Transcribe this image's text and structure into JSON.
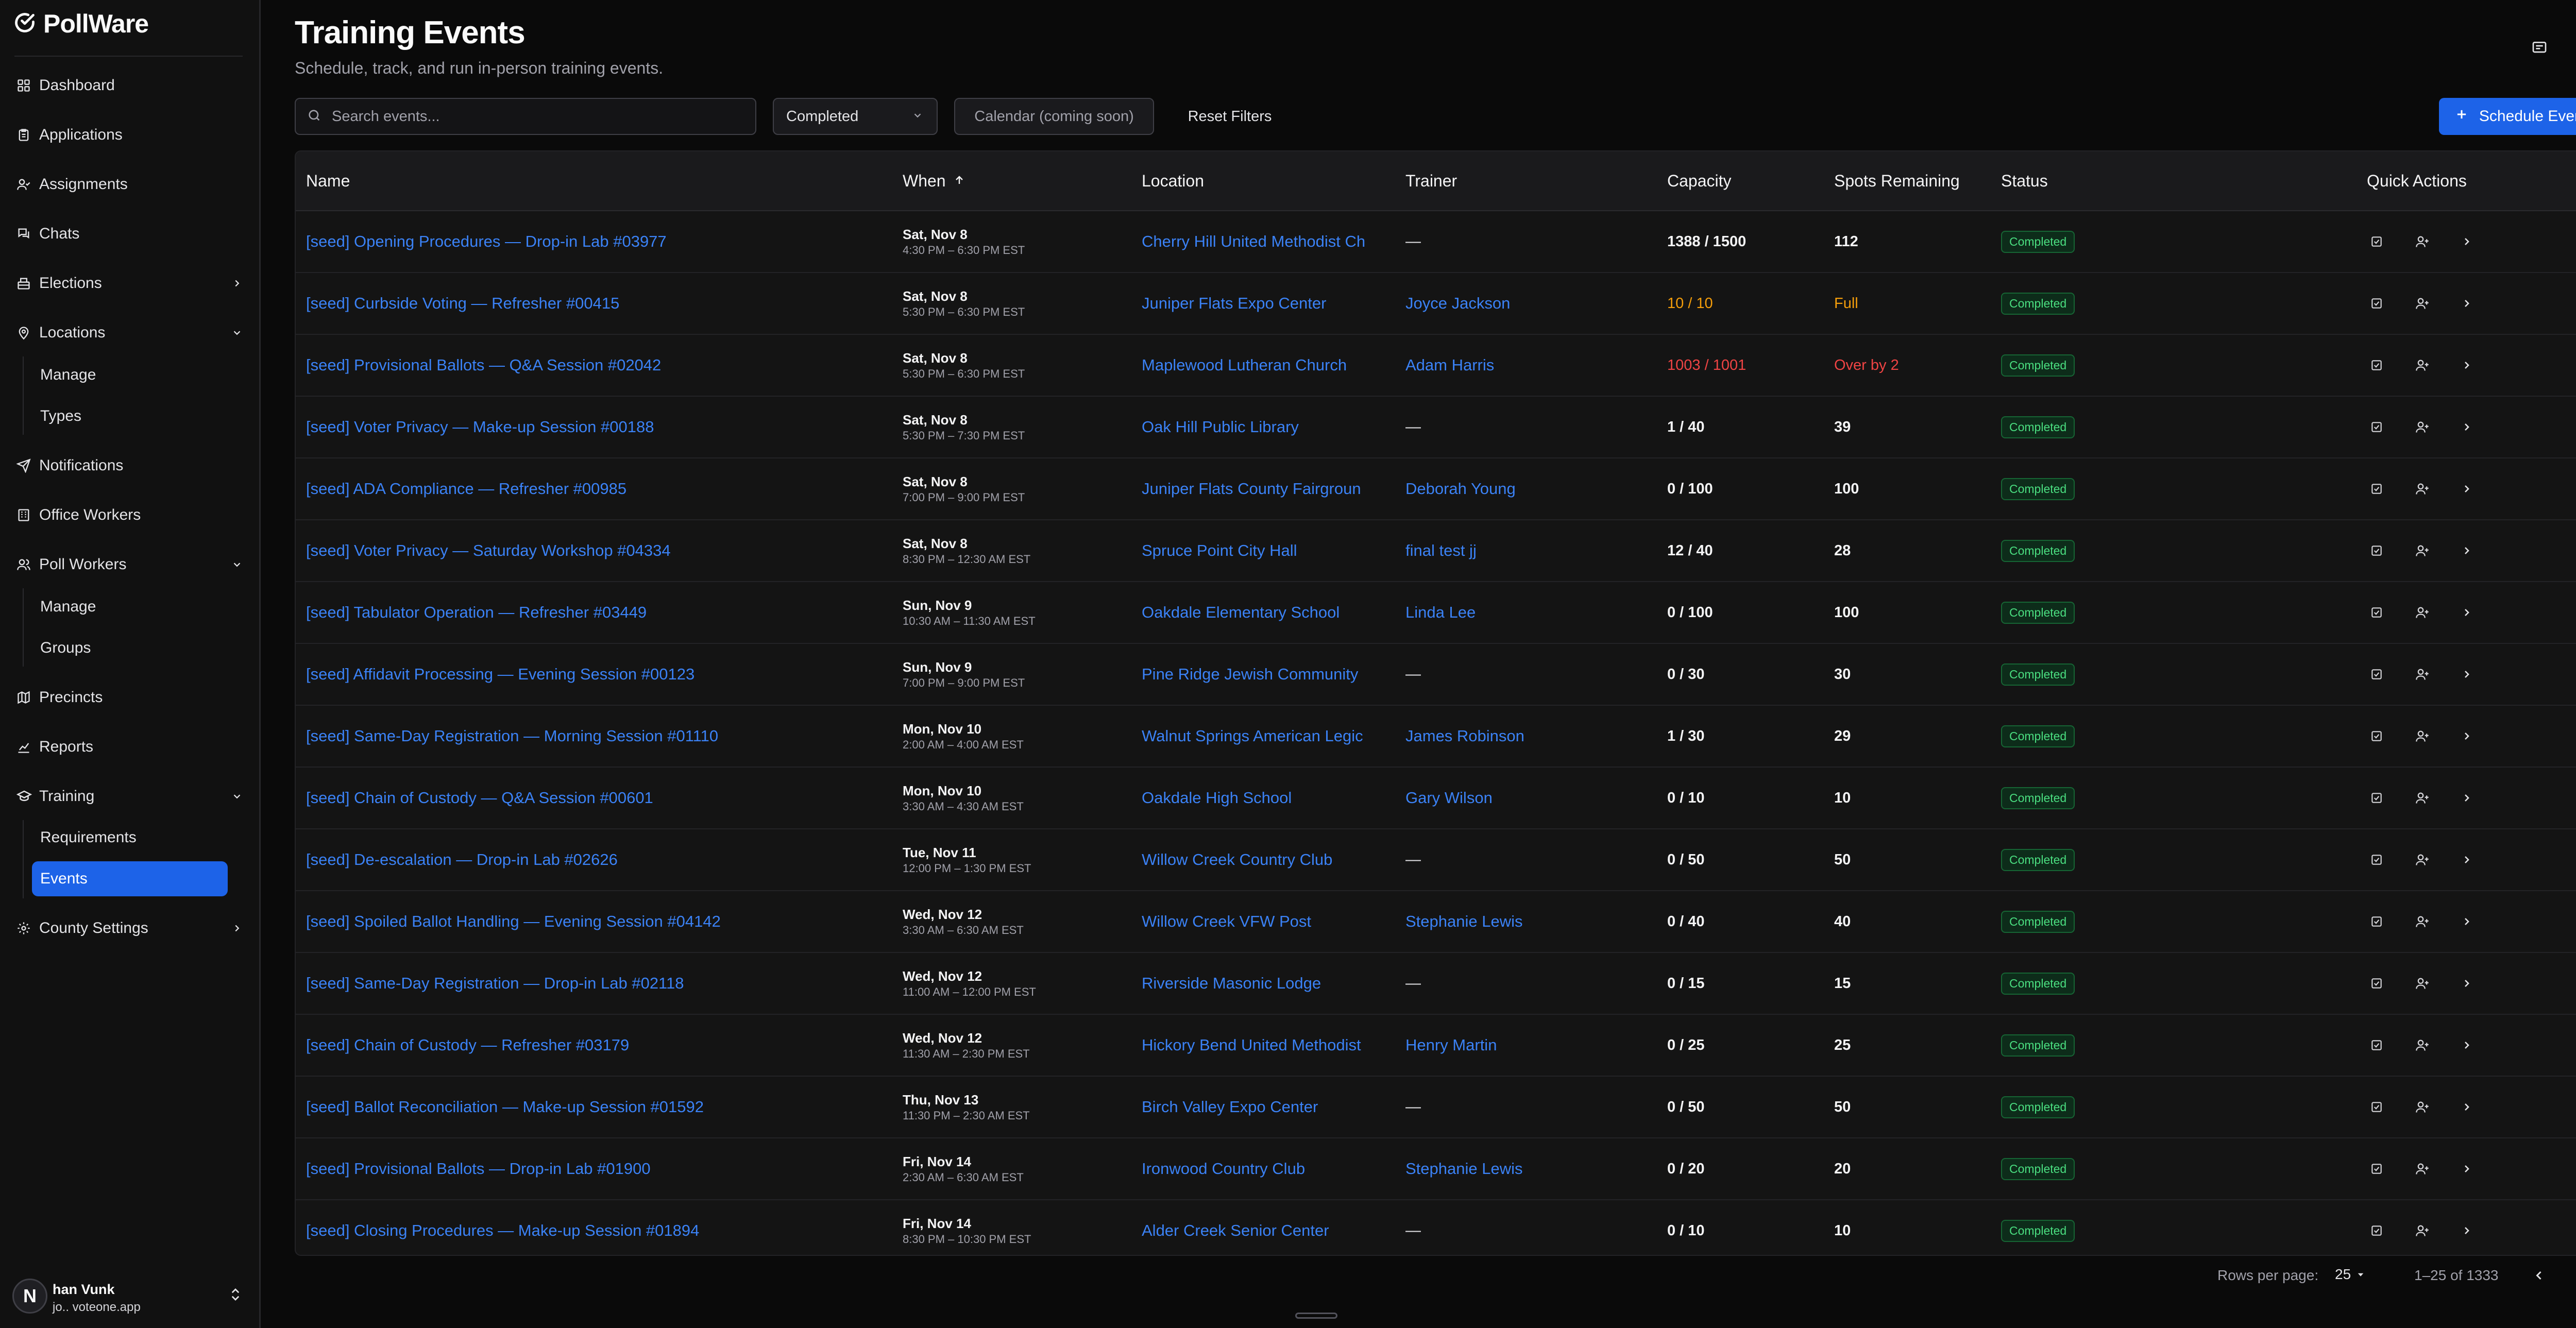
{
  "app": {
    "name": "PollWare"
  },
  "sidebar": {
    "items": [
      {
        "label": "Dashboard",
        "icon": "dashboard-icon"
      },
      {
        "label": "Applications",
        "icon": "clipboard-icon"
      },
      {
        "label": "Assignments",
        "icon": "user-check-icon"
      },
      {
        "label": "Chats",
        "icon": "chat-icon"
      },
      {
        "label": "Elections",
        "icon": "ballot-box-icon"
      },
      {
        "label": "Locations",
        "icon": "map-pin-icon"
      },
      {
        "label": "Manage"
      },
      {
        "label": "Types"
      },
      {
        "label": "Notifications",
        "icon": "send-icon"
      },
      {
        "label": "Office Workers",
        "icon": "building-icon"
      },
      {
        "label": "Poll Workers",
        "icon": "users-icon"
      },
      {
        "label": "Manage"
      },
      {
        "label": "Groups"
      },
      {
        "label": "Precincts",
        "icon": "map-icon"
      },
      {
        "label": "Reports",
        "icon": "chart-icon"
      },
      {
        "label": "Training",
        "icon": "graduation-cap-icon"
      },
      {
        "label": "Requirements"
      },
      {
        "label": "Events"
      },
      {
        "label": "County Settings",
        "icon": "gear-icon"
      }
    ],
    "user": {
      "avatar_letter": "N",
      "name": "han Vunk",
      "email": "jo.. voteone.app"
    }
  },
  "header": {
    "title": "Training Events",
    "subtitle": "Schedule, track, and run in-person training events."
  },
  "filters": {
    "search_placeholder": "Search events...",
    "status_value": "Completed",
    "calendar_label": "Calendar (coming soon)",
    "reset_label": "Reset Filters",
    "schedule_label": "Schedule Event"
  },
  "table": {
    "columns": [
      "Name",
      "When",
      "Location",
      "Trainer",
      "Capacity",
      "Spots Remaining",
      "Status",
      "Quick Actions"
    ],
    "rows": [
      {
        "name": "[seed] Opening Procedures — Drop-in Lab #03977",
        "date": "Sat, Nov 8",
        "time": "4:30 PM – 6:30 PM EST",
        "location": "Cherry Hill United Methodist Ch",
        "trainer": "—",
        "capacity": "1388 / 1500",
        "spots": "112",
        "status": "Completed",
        "state": "normal"
      },
      {
        "name": "[seed] Curbside Voting — Refresher #00415",
        "date": "Sat, Nov 8",
        "time": "5:30 PM – 6:30 PM EST",
        "location": "Juniper Flats Expo Center",
        "trainer": "Joyce Jackson",
        "capacity": "10 / 10",
        "spots": "Full",
        "status": "Completed",
        "state": "full"
      },
      {
        "name": "[seed] Provisional Ballots — Q&A Session #02042",
        "date": "Sat, Nov 8",
        "time": "5:30 PM – 6:30 PM EST",
        "location": "Maplewood Lutheran Church",
        "trainer": "Adam Harris",
        "capacity": "1003 / 1001",
        "spots": "Over by 2",
        "status": "Completed",
        "state": "over"
      },
      {
        "name": "[seed] Voter Privacy — Make-up Session #00188",
        "date": "Sat, Nov 8",
        "time": "5:30 PM – 7:30 PM EST",
        "location": "Oak Hill Public Library",
        "trainer": "—",
        "capacity": "1 / 40",
        "spots": "39",
        "status": "Completed",
        "state": "normal"
      },
      {
        "name": "[seed] ADA Compliance — Refresher #00985",
        "date": "Sat, Nov 8",
        "time": "7:00 PM – 9:00 PM EST",
        "location": "Juniper Flats County Fairgroun",
        "trainer": "Deborah Young",
        "capacity": "0 / 100",
        "spots": "100",
        "status": "Completed",
        "state": "normal"
      },
      {
        "name": "[seed] Voter Privacy — Saturday Workshop #04334",
        "date": "Sat, Nov 8",
        "time": "8:30 PM – 12:30 AM EST",
        "location": "Spruce Point City Hall",
        "trainer": "final test jj",
        "capacity": "12 / 40",
        "spots": "28",
        "status": "Completed",
        "state": "normal"
      },
      {
        "name": "[seed] Tabulator Operation — Refresher #03449",
        "date": "Sun, Nov 9",
        "time": "10:30 AM – 11:30 AM EST",
        "location": "Oakdale Elementary School",
        "trainer": "Linda Lee",
        "capacity": "0 / 100",
        "spots": "100",
        "status": "Completed",
        "state": "normal"
      },
      {
        "name": "[seed] Affidavit Processing — Evening Session #00123",
        "date": "Sun, Nov 9",
        "time": "7:00 PM – 9:00 PM EST",
        "location": "Pine Ridge Jewish Community",
        "trainer": "—",
        "capacity": "0 / 30",
        "spots": "30",
        "status": "Completed",
        "state": "normal"
      },
      {
        "name": "[seed] Same-Day Registration — Morning Session #01110",
        "date": "Mon, Nov 10",
        "time": "2:00 AM – 4:00 AM EST",
        "location": "Walnut Springs American Legic",
        "trainer": "James Robinson",
        "capacity": "1 / 30",
        "spots": "29",
        "status": "Completed",
        "state": "normal"
      },
      {
        "name": "[seed] Chain of Custody — Q&A Session #00601",
        "date": "Mon, Nov 10",
        "time": "3:30 AM – 4:30 AM EST",
        "location": "Oakdale High School",
        "trainer": "Gary Wilson",
        "capacity": "0 / 10",
        "spots": "10",
        "status": "Completed",
        "state": "normal"
      },
      {
        "name": "[seed] De-escalation — Drop-in Lab #02626",
        "date": "Tue, Nov 11",
        "time": "12:00 PM – 1:30 PM EST",
        "location": "Willow Creek Country Club",
        "trainer": "—",
        "capacity": "0 / 50",
        "spots": "50",
        "status": "Completed",
        "state": "normal"
      },
      {
        "name": "[seed] Spoiled Ballot Handling — Evening Session #04142",
        "date": "Wed, Nov 12",
        "time": "3:30 AM – 6:30 AM EST",
        "location": "Willow Creek VFW Post",
        "trainer": "Stephanie Lewis",
        "capacity": "0 / 40",
        "spots": "40",
        "status": "Completed",
        "state": "normal"
      },
      {
        "name": "[seed] Same-Day Registration — Drop-in Lab #02118",
        "date": "Wed, Nov 12",
        "time": "11:00 AM – 12:00 PM EST",
        "location": "Riverside Masonic Lodge",
        "trainer": "—",
        "capacity": "0 / 15",
        "spots": "15",
        "status": "Completed",
        "state": "normal"
      },
      {
        "name": "[seed] Chain of Custody — Refresher #03179",
        "date": "Wed, Nov 12",
        "time": "11:30 AM – 2:30 PM EST",
        "location": "Hickory Bend United Methodist",
        "trainer": "Henry Martin",
        "capacity": "0 / 25",
        "spots": "25",
        "status": "Completed",
        "state": "normal"
      },
      {
        "name": "[seed] Ballot Reconciliation — Make-up Session #01592",
        "date": "Thu, Nov 13",
        "time": "11:30 PM – 2:30 AM EST",
        "location": "Birch Valley Expo Center",
        "trainer": "—",
        "capacity": "0 / 50",
        "spots": "50",
        "status": "Completed",
        "state": "normal"
      },
      {
        "name": "[seed] Provisional Ballots — Drop-in Lab #01900",
        "date": "Fri, Nov 14",
        "time": "2:30 AM – 6:30 AM EST",
        "location": "Ironwood Country Club",
        "trainer": "Stephanie Lewis",
        "capacity": "0 / 20",
        "spots": "20",
        "status": "Completed",
        "state": "normal"
      },
      {
        "name": "[seed] Closing Procedures — Make-up Session #01894",
        "date": "Fri, Nov 14",
        "time": "8:30 PM – 10:30 PM EST",
        "location": "Alder Creek Senior Center",
        "trainer": "—",
        "capacity": "0 / 10",
        "spots": "10",
        "status": "Completed",
        "state": "normal"
      }
    ]
  },
  "pagination": {
    "rows_per_page_label": "Rows per page:",
    "rows_per_page_value": "25",
    "range": "1–25 of 1333"
  },
  "colors": {
    "accent": "#1d63e8",
    "link": "#3b82f6",
    "warning": "#f59e0b",
    "danger": "#ef4444",
    "status_green": "#4ade80"
  }
}
